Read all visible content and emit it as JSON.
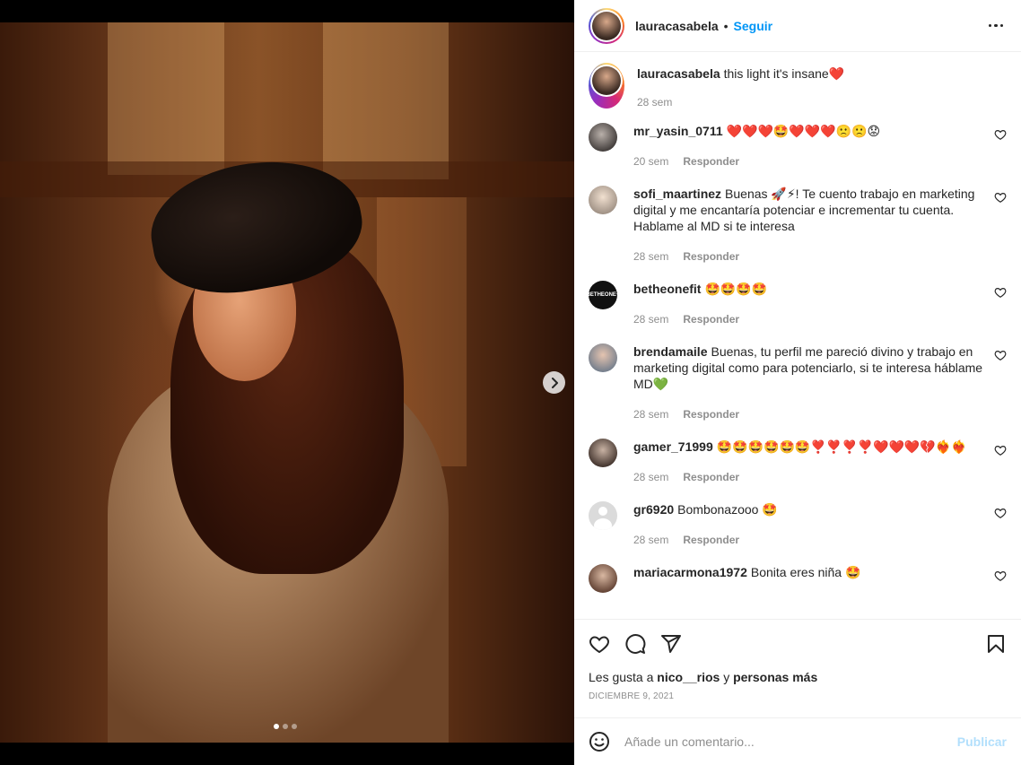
{
  "author": {
    "username": "lauracasabela",
    "separator": "•",
    "follow_label": "Seguir"
  },
  "caption": {
    "username": "lauracasabela",
    "text": "this light it's insane❤️",
    "time": "28 sem"
  },
  "comments": [
    {
      "username": "mr_yasin_0711",
      "text": "❤️❤️❤️🤩❤️❤️❤️🙁🙁😟",
      "time": "20 sem",
      "reply_label": "Responder"
    },
    {
      "username": "sofi_maartinez",
      "text": "Buenas 🚀⚡! Te cuento trabajo en marketing digital y me encantaría potenciar e incrementar tu cuenta. Hablame al MD si te interesa",
      "time": "28 sem",
      "reply_label": "Responder"
    },
    {
      "username": "betheonefit",
      "text": "🤩🤩🤩🤩",
      "time": "28 sem",
      "reply_label": "Responder",
      "avatar_text": "BETHEONE+"
    },
    {
      "username": "brendamaile",
      "text": "Buenas, tu perfil me pareció divino y trabajo en marketing digital como para potenciarlo, si te interesa háblame MD💚",
      "time": "28 sem",
      "reply_label": "Responder"
    },
    {
      "username": "gamer_71999",
      "text": "🤩🤩🤩🤩🤩🤩❣️❣️❣️❣️❤️❤️❤️💔❤️‍🔥❤️‍🔥",
      "time": "28 sem",
      "reply_label": "Responder"
    },
    {
      "username": "gr6920",
      "text": "Bombonazooo 🤩",
      "time": "28 sem",
      "reply_label": "Responder"
    },
    {
      "username": "mariacarmona1972",
      "text": "Bonita eres niña 🤩",
      "time": "",
      "reply_label": ""
    }
  ],
  "likes": {
    "prefix": "Les gusta a",
    "user": "nico__rios",
    "middle": "y",
    "suffix": "personas más"
  },
  "date": "DICIEMBRE 9, 2021",
  "add_comment": {
    "placeholder": "Añade un comentario...",
    "post_label": "Publicar"
  },
  "carousel": {
    "total": 3,
    "active": 1
  },
  "colors": {
    "link": "#0095f6",
    "muted": "#8e8e8e",
    "post_disabled": "#b2dffc"
  }
}
